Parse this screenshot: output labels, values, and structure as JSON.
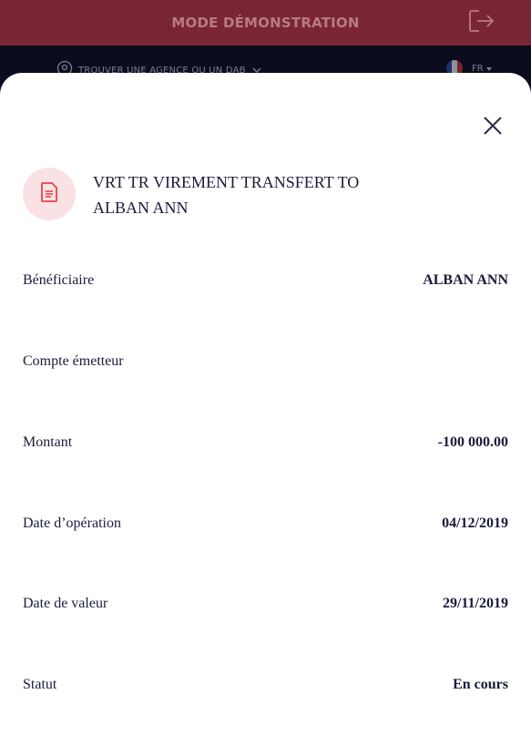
{
  "top_bar": {
    "title": "MODE DÉMONSTRATION",
    "background_color": "#7a2534",
    "logout_icon": "logout-icon"
  },
  "sub_bar": {
    "agency_link": "TROUVER UNE AGENCE OU UN DAB",
    "language": "FR",
    "location_icon": "location-pin-icon",
    "flag_icon": "france-flag-icon"
  },
  "modal": {
    "close_icon": "close-icon",
    "header_icon": "document-icon",
    "accent_color": "#e8434f",
    "title": "VRT TR VIREMENT TRANSFERT TO ALBAN ANN",
    "details": [
      {
        "label": "Bénéficiaire",
        "value": "ALBAN ANN"
      },
      {
        "label": "Compte émetteur",
        "value": ""
      },
      {
        "label": "Montant",
        "value": "-100 000.00"
      },
      {
        "label": "Date d’opération",
        "value": "04/12/2019"
      },
      {
        "label": "Date de valeur",
        "value": "29/11/2019"
      },
      {
        "label": "Statut",
        "value": "En cours"
      }
    ]
  }
}
